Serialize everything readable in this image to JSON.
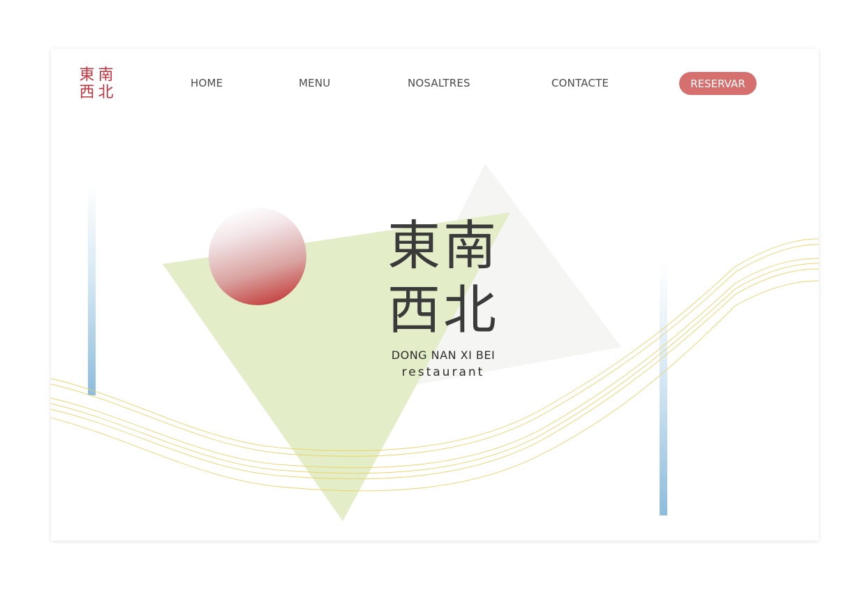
{
  "logo": {
    "chars": [
      "東",
      "南",
      "西",
      "北"
    ]
  },
  "nav": {
    "items": [
      {
        "label": "HOME"
      },
      {
        "label": "MENU"
      },
      {
        "label": "NOSALTRES"
      },
      {
        "label": "CONTACTE"
      }
    ],
    "reserve_label": "RESERVAR"
  },
  "hero": {
    "title_chars": [
      "東",
      "南",
      "西",
      "北"
    ],
    "subtitle": "DONG NAN XI BEI",
    "tagline": "restaurant"
  },
  "colors": {
    "brand_red": "#c6323b",
    "button": "#d6706f",
    "triangle_green": "#e3edc7",
    "triangle_grey": "#f5f5f3",
    "bar_blue": "#8dbcdc",
    "wave_yellow": "#ecd36a"
  }
}
